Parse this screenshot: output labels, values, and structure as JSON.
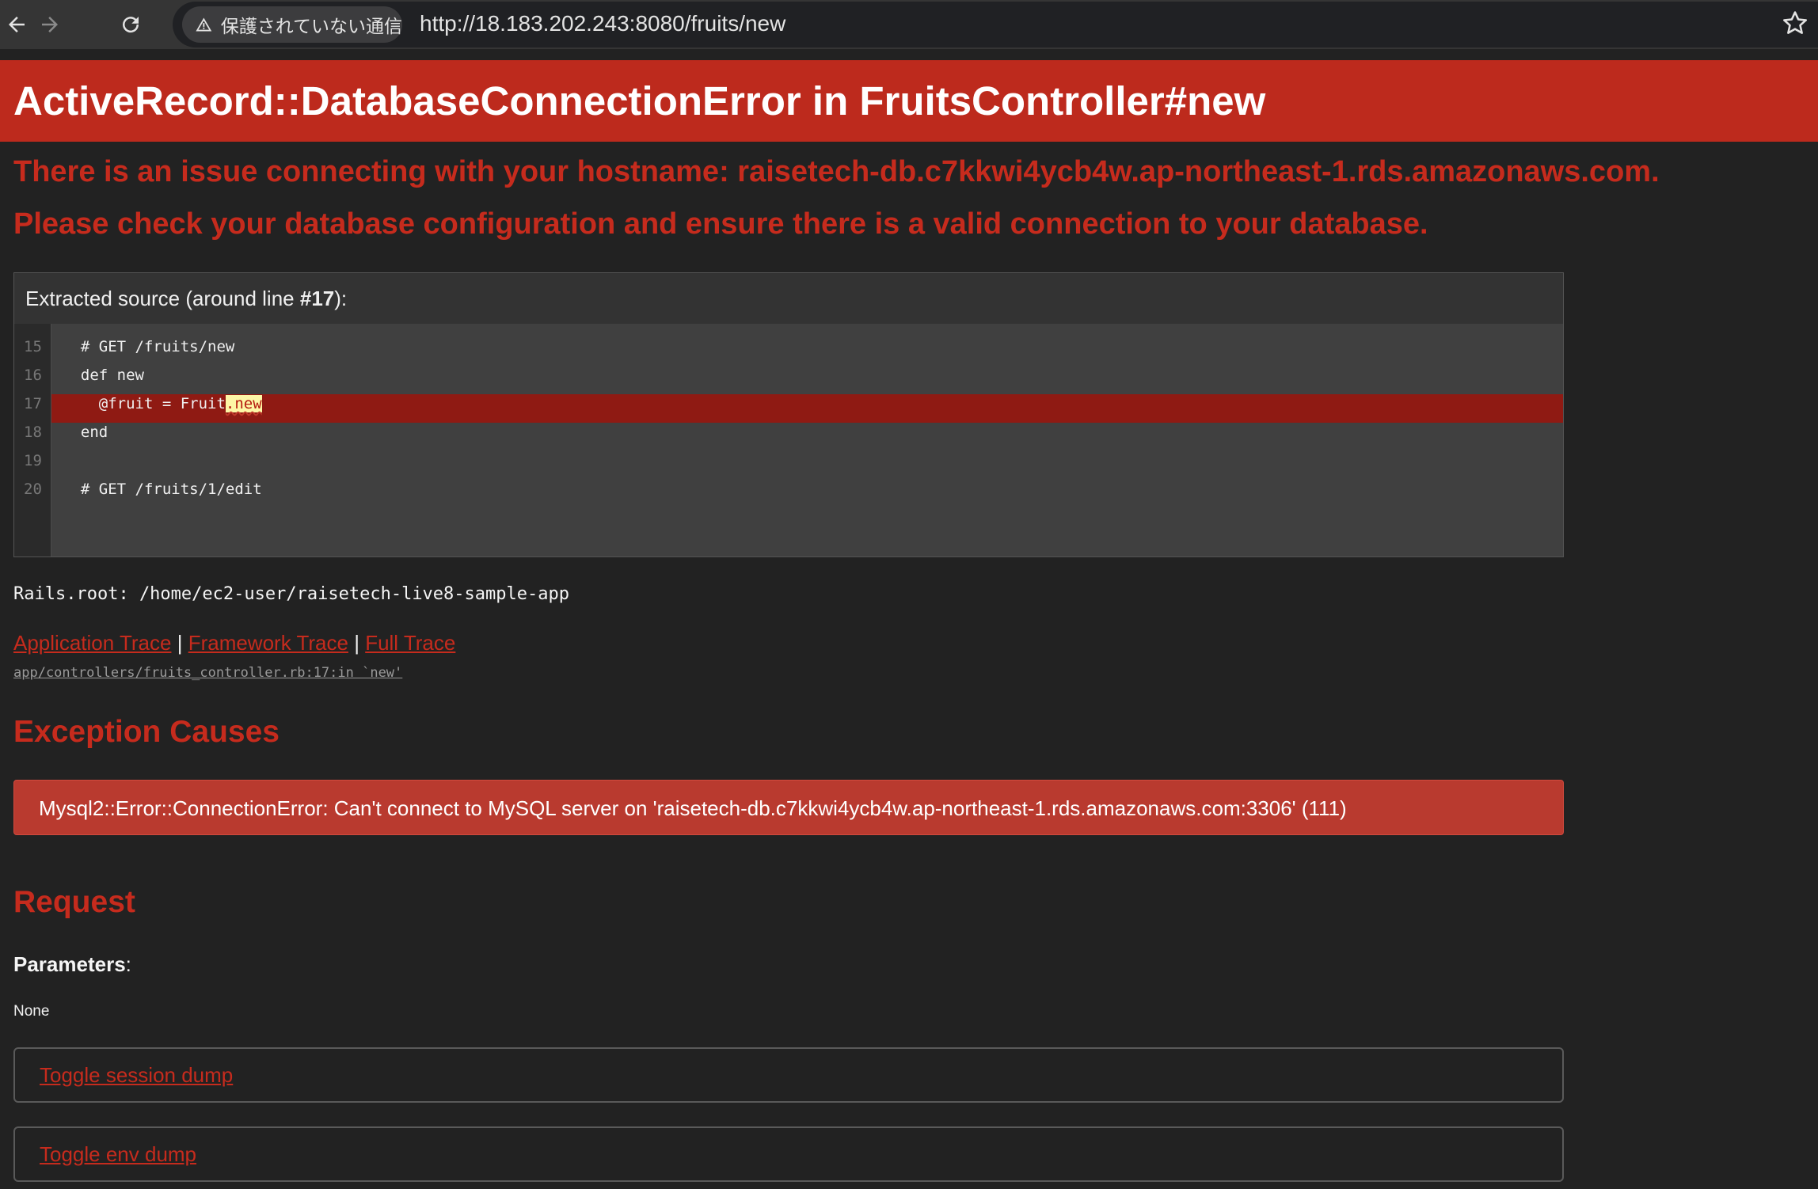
{
  "browser": {
    "security_label": "保護されていない通信",
    "url": "http://18.183.202.243:8080/fruits/new"
  },
  "page": {
    "title": "ActiveRecord::DatabaseConnectionError in FruitsController#new",
    "message_line1": "There is an issue connecting with your hostname: raisetech-db.c7kkwi4ycb4w.ap-northeast-1.rds.amazonaws.com.",
    "message_line2": "Please check your database configuration and ensure there is a valid connection to your database.",
    "source": {
      "caption_prefix": "Extracted source (around line ",
      "caption_line": "#17",
      "caption_suffix": "):",
      "line_numbers": [
        "15",
        "16",
        "17",
        "18",
        "19",
        "20"
      ],
      "lines": [
        "  # GET /fruits/new",
        "  def new",
        "    @fruit = Fruit",
        "  end",
        "",
        "  # GET /fruits/1/edit"
      ],
      "highlight_mark": ".new"
    },
    "rails_root": "Rails.root: /home/ec2-user/raisetech-live8-sample-app",
    "trace": {
      "application": "Application Trace",
      "framework": "Framework Trace",
      "full": "Full Trace",
      "separator": "|",
      "frame": "app/controllers/fruits_controller.rb:17:in `new'"
    },
    "exception_causes": {
      "heading": "Exception Causes",
      "cause": "Mysql2::Error::ConnectionError: Can't connect to MySQL server on 'raisetech-db.c7kkwi4ycb4w.ap-northeast-1.rds.amazonaws.com:3306' (111)"
    },
    "request": {
      "heading": "Request",
      "parameters_label": "Parameters",
      "parameters_colon": ":",
      "parameters_value": "None"
    },
    "toggles": {
      "session": "Toggle session dump",
      "env": "Toggle env dump"
    }
  },
  "colors": {
    "header_red": "#bd2a1d",
    "text_red": "#c62b1d",
    "background": "#222222",
    "highlight_line": "#8f1a13"
  }
}
